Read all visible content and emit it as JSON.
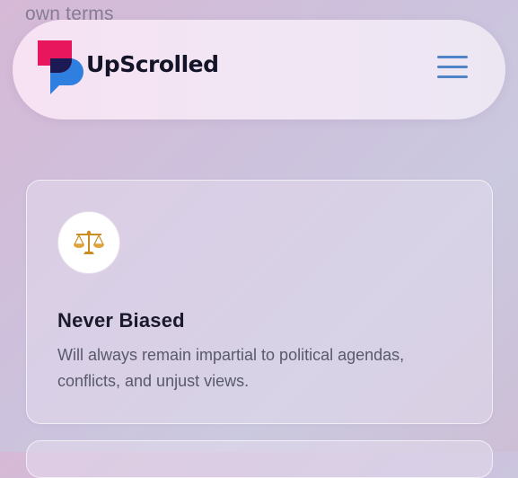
{
  "background": {
    "partial_text": "own terms"
  },
  "header": {
    "brand_name": "UpScrolled",
    "logo_icon": "upscrolled-logo-icon",
    "menu_icon": "hamburger-menu-icon",
    "colors": {
      "logo_pink": "#e8175d",
      "logo_blue": "#2f7fe0",
      "logo_navy": "#1c1a55",
      "menu": "#4f86c9"
    }
  },
  "feature_card": {
    "icon": "balance-scale-icon",
    "title": "Never Biased",
    "description": "Will always remain impartial to political agendas, conflicts, and unjust views."
  }
}
